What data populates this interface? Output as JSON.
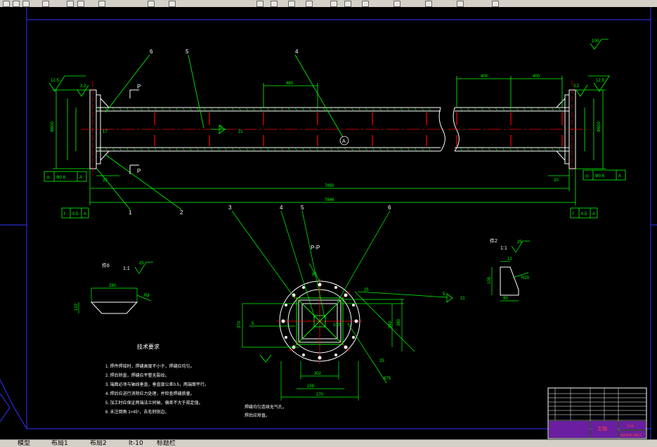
{
  "colors": {
    "background": "#000000",
    "dim": "#00ff00",
    "outline": "#ffffff",
    "center": "#ff0000",
    "frame": "#3333ff",
    "leader": "#00ff00"
  },
  "main_view": {
    "callouts": [
      "6",
      "5",
      "4",
      "1",
      "2"
    ],
    "dims": {
      "overall_inner": "7850",
      "overall": "7846",
      "d480": "480",
      "d400": "400",
      "d12_5": "12.5",
      "d3_2": "3.2",
      "d32": "32",
      "d20": "20",
      "d600": "Φ600",
      "d17": "17",
      "d21": "21"
    },
    "section_marks": [
      "P",
      "P"
    ],
    "detail_circle": "A",
    "roughness": "100",
    "tolerance_left": [
      "◎",
      "Φ0.6",
      "A"
    ],
    "tolerance_right": [
      "◎",
      "Φ0.6",
      "A"
    ],
    "flatness_left": [
      "f",
      "0.5",
      "A"
    ],
    "flatness_right": [
      "f",
      "0.5",
      "A"
    ],
    "weld_label": "5"
  },
  "section_view": {
    "title": "P-P",
    "callouts": [
      "3",
      "4",
      "5",
      "6"
    ],
    "dims": {
      "w370": "370",
      "w380": "380",
      "w340": "340",
      "w302": "302",
      "w100": "100",
      "w159": "159",
      "w270": "270",
      "w80": "80",
      "w25": "25",
      "w675": "675",
      "d5": "5",
      "d21": "21"
    }
  },
  "detail_left": {
    "title": "件6",
    "scale": "1:1",
    "roughness": "25",
    "dims": {
      "w": "280",
      "h": "122",
      "r": "R8"
    }
  },
  "detail_right": {
    "title": "件2",
    "scale": "1:1",
    "roughness": "25",
    "dims": {
      "a": "12",
      "b": "80",
      "r": "R20",
      "h": "105"
    }
  },
  "notes": {
    "title": "技术要求",
    "items": [
      "1. 焊件焊接时，焊缝高度不小于，焊缝应均匀。",
      "2. 焊后矫直，焊缝应平整无裂纹。",
      "3. 端面必须与轴线垂直，垂直度公差0.5，两端面平行。",
      "4. 焊后应进行消除应力处理，并检查焊缝质量。",
      "5. 加工时应保证两端法兰同轴，偏差不大于规定值。",
      "6. 未注倒角 1×45°，去毛刺锐边。"
    ],
    "section_note_1": "焊缝均匀连续无气孔，",
    "section_note_2": "焊后应矫直。"
  },
  "title_block": {
    "part_name": "主轴",
    "drawing_no": "SDXHF-0001",
    "scale": "1:10"
  },
  "tabs": [
    "模型",
    "布局1",
    "布局2",
    "lt-10",
    "标题栏"
  ]
}
